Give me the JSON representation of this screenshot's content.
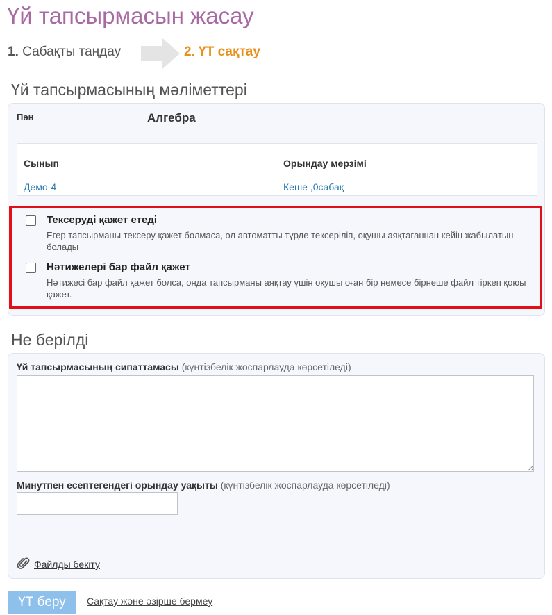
{
  "page": {
    "title": "Үй тапсырмасын жасау"
  },
  "steps": {
    "step1_number": "1.",
    "step1_label": "Сабақты таңдау",
    "step2_label": "2. ҮТ сақтау"
  },
  "details": {
    "section_title": "Үй тапсырмасының мәліметтері",
    "subject_label": "Пән",
    "subject_value": "Алгебра",
    "table": {
      "headers": [
        "Сынып",
        "Орындау мерзімі"
      ],
      "row": [
        "Демо-4",
        "Кеше ,0сабақ"
      ]
    },
    "options": [
      {
        "title": "Тексеруді қажет етеді",
        "description": "Егер тапсырманы тексеру қажет болмаса, ол автоматты түрде тексеріліп, оқушы аяқтағаннан кейін жабылатын болады",
        "checked": false
      },
      {
        "title": "Нәтижелері бар файл қажет",
        "description": "Нәтижесі бар файл қажет болса, онда тапсырманы аяқтау үшін оқушы оған бір немесе бірнеше файл тіркеп қоюы қажет.",
        "checked": false
      }
    ]
  },
  "given": {
    "section_title": "Не берілді",
    "description_label": "Үй тапсырмасының сипаттамасы",
    "description_hint": "(күнтізбелік жоспарлауда көрсетіледі)",
    "description_value": "",
    "minutes_label": "Минутпен есептегендегі орындау уақыты",
    "minutes_hint": "(күнтізбелік жоспарлауда көрсетіледі)",
    "minutes_value": "",
    "attach_label": "Файлды бекіту"
  },
  "actions": {
    "submit_label": "ҮТ беру",
    "save_label": "Сақтау және әзірше бермеу"
  },
  "colors": {
    "title": "#a86aa3",
    "step_active": "#e8901c",
    "link": "#2a7ab0",
    "highlight_border": "#e10f17",
    "submit_button": "#8ec0ec"
  },
  "icons": [
    "step-arrow-icon",
    "paperclip-icon",
    "checkbox-icon",
    "resize-grip-icon"
  ]
}
